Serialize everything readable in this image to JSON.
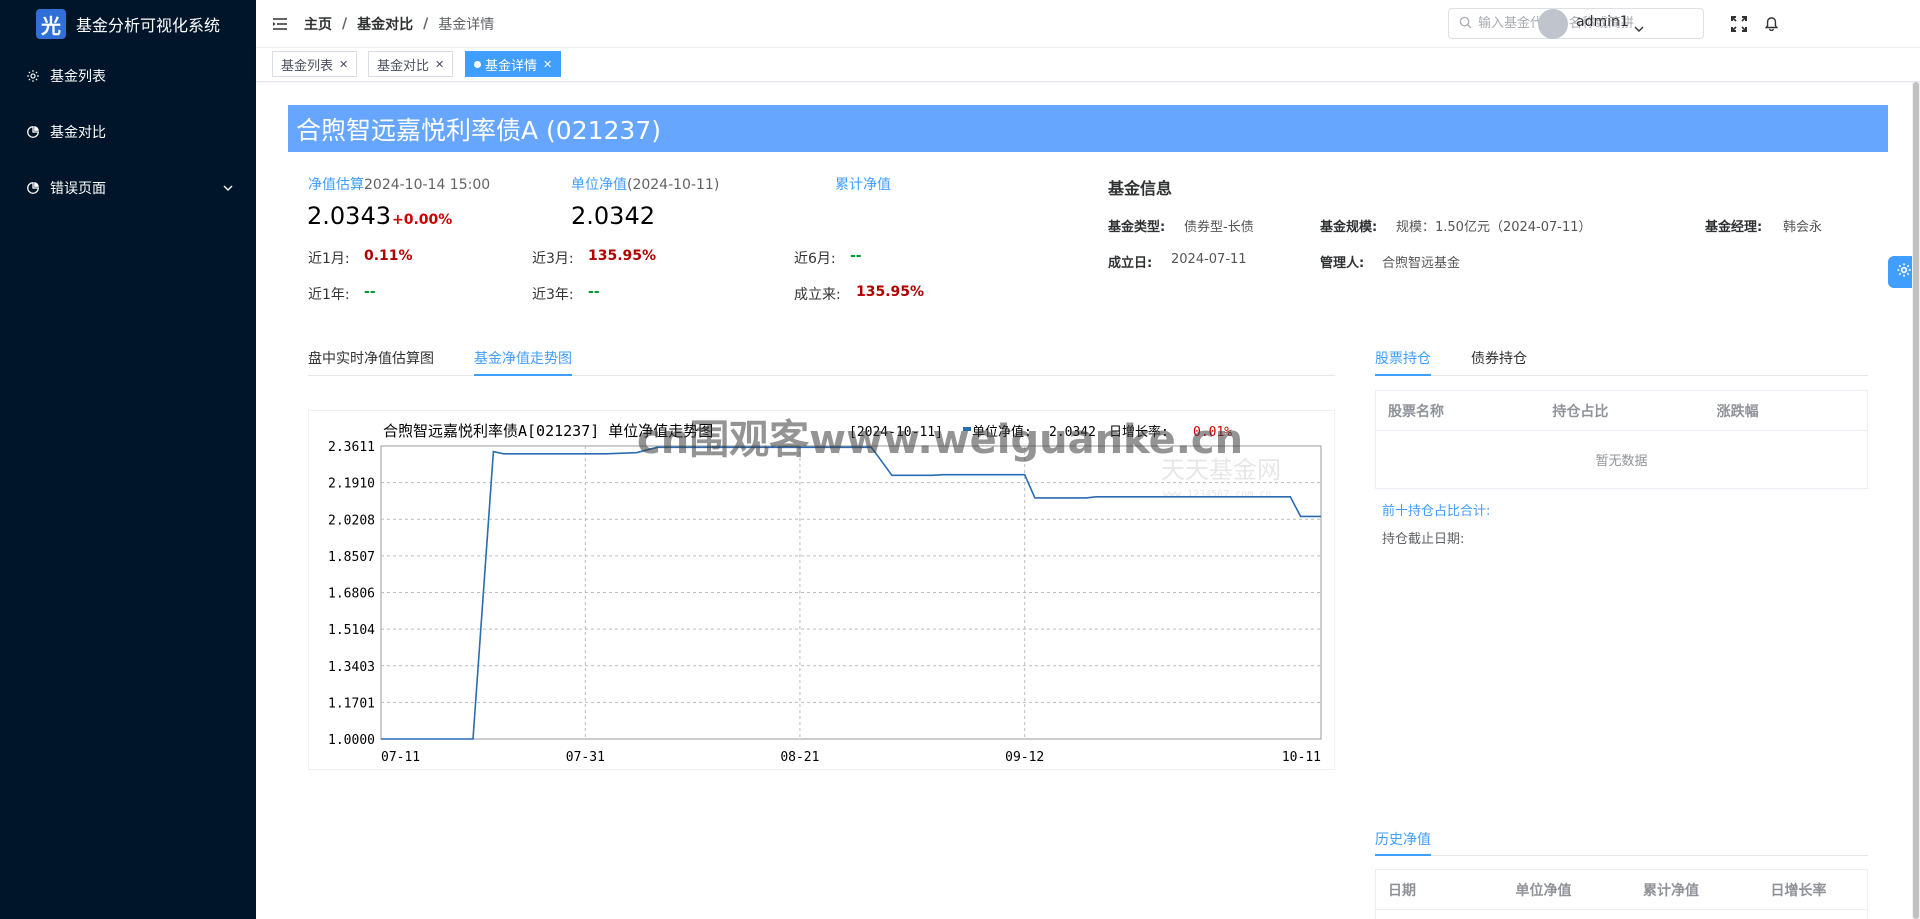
{
  "app": {
    "logo_glyph": "光",
    "title": "基金分析可视化系统"
  },
  "sidebar": {
    "items": [
      {
        "label": "基金列表",
        "icon": "gear-icon"
      },
      {
        "label": "基金对比",
        "icon": "chart-icon"
      },
      {
        "label": "错误页面",
        "icon": "chart-icon",
        "has_submenu": true
      }
    ]
  },
  "breadcrumb": {
    "home": "主页",
    "sep": "/",
    "level2": "基金对比",
    "current": "基金详情"
  },
  "search": {
    "placeholder": "输入基金代码、名称或简拼"
  },
  "user": {
    "name": "admin1"
  },
  "tags": [
    {
      "label": "基金列表"
    },
    {
      "label": "基金对比"
    },
    {
      "label": "基金详情",
      "active": true
    }
  ],
  "fund": {
    "title": "合煦智远嘉悦利率债A (021237)",
    "est_label": "净值估算",
    "est_time": "2024-10-14 15:00",
    "est_value": "2.0343",
    "est_change": "+0.00%",
    "unit_label": "单位净值",
    "unit_date": "(2024-10-11)",
    "unit_value": "2.0342",
    "acc_label": "累计净值",
    "stats": [
      {
        "label": "近1月:",
        "value": "0.11%",
        "tone": "red"
      },
      {
        "label": "近3月:",
        "value": "135.95%",
        "tone": "red"
      },
      {
        "label": "近6月:",
        "value": "--",
        "tone": "green"
      },
      {
        "label": "近1年:",
        "value": "--",
        "tone": "green"
      },
      {
        "label": "近3年:",
        "value": "--",
        "tone": "green"
      },
      {
        "label": "成立来:",
        "value": "135.95%",
        "tone": "red"
      }
    ]
  },
  "info": {
    "title": "基金信息",
    "type_label": "基金类型:",
    "type_value": "债券型-长债",
    "scale_label": "基金规模:",
    "scale_value": "规模：1.50亿元（2024-07-11）",
    "manager_label": "基金经理:",
    "manager_value": "韩会永",
    "inception_label": "成立日:",
    "inception_value": "2024-07-11",
    "custodian_label": "管理人:",
    "custodian_value": "合煦智远基金"
  },
  "chart_tabs": {
    "tab1": "盘中实时净值估算图",
    "tab2": "基金净值走势图"
  },
  "right_tabs": {
    "tab1": "股票持仓",
    "tab2": "债券持仓"
  },
  "holdings": {
    "headers": [
      "股票名称",
      "持仓占比",
      "涨跌幅"
    ],
    "empty": "暂无数据",
    "top10_label": "前十持仓占比合计:",
    "as_of_label": "持仓截止日期:"
  },
  "history": {
    "tab": "历史净值",
    "headers": [
      "日期",
      "单位净值",
      "累计净值",
      "日增长率"
    ]
  },
  "chart_data": {
    "type": "line",
    "title": "合煦智远嘉悦利率债A[021237] 单位净值走势图",
    "legend_date": "[2024-10-11]",
    "legend_series": "单位净值:",
    "legend_value": "2.0342",
    "legend_growth_label": "日增长率:",
    "legend_growth_value": "0.01%",
    "watermark_text": "天天基金网",
    "watermark_sub": "www.1234567.com.cn",
    "overlay_watermark": "cn围观客www.weiguanke.cn",
    "y_ticks": [
      "2.3611",
      "2.1910",
      "2.0208",
      "1.8507",
      "1.6806",
      "1.5104",
      "1.3403",
      "1.1701",
      "1.0000"
    ],
    "x_ticks": [
      "07-11",
      "07-31",
      "08-21",
      "09-12",
      "10-11"
    ],
    "ylim": [
      1.0,
      2.3611
    ],
    "series_color": "#2a6bb3",
    "points": [
      {
        "x": "2024-07-11",
        "y": 1.0
      },
      {
        "x": "2024-07-19",
        "y": 1.0
      },
      {
        "x": "2024-07-20",
        "y": 1.0
      },
      {
        "x": "2024-07-22",
        "y": 2.335
      },
      {
        "x": "2024-07-23",
        "y": 2.325
      },
      {
        "x": "2024-07-31",
        "y": 2.325
      },
      {
        "x": "2024-08-02",
        "y": 2.325
      },
      {
        "x": "2024-08-05",
        "y": 2.33
      },
      {
        "x": "2024-08-07",
        "y": 2.355
      },
      {
        "x": "2024-08-21",
        "y": 2.355
      },
      {
        "x": "2024-08-28",
        "y": 2.355
      },
      {
        "x": "2024-08-30",
        "y": 2.225
      },
      {
        "x": "2024-09-03",
        "y": 2.225
      },
      {
        "x": "2024-09-04",
        "y": 2.228
      },
      {
        "x": "2024-09-10",
        "y": 2.228
      },
      {
        "x": "2024-09-12",
        "y": 2.228
      },
      {
        "x": "2024-09-13",
        "y": 2.12
      },
      {
        "x": "2024-09-18",
        "y": 2.12
      },
      {
        "x": "2024-09-19",
        "y": 2.125
      },
      {
        "x": "2024-09-30",
        "y": 2.125
      },
      {
        "x": "2024-10-08",
        "y": 2.125
      },
      {
        "x": "2024-10-09",
        "y": 2.034
      },
      {
        "x": "2024-10-11",
        "y": 2.0342
      }
    ]
  }
}
